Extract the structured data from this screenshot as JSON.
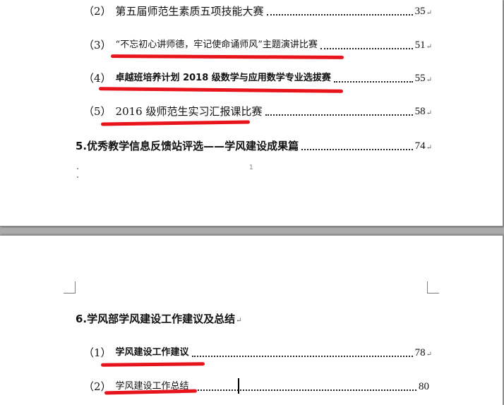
{
  "page1": {
    "entries": [
      {
        "num": "（2）",
        "title": "第五届师范生素质五项技能大赛",
        "page": "35"
      },
      {
        "num": "（3）",
        "title": "“不忘初心讲师德，牢记使命诵师风”主题演讲比赛",
        "page": "51"
      },
      {
        "num": "（4）",
        "title": "卓越班培养计划 2018 级数学与应用数学专业选拔赛",
        "page": "55"
      },
      {
        "num": "（5）",
        "title": "2016 级师范生实习汇报课比赛",
        "page": "58"
      }
    ],
    "section5": {
      "title": "5.优秀教学信息反馈站评选——学风建设成果篇",
      "page": "74"
    },
    "footer_page_number": "1"
  },
  "page2": {
    "section6": {
      "title": "6.学风部学风建设工作建议及总结"
    },
    "entries": [
      {
        "num": "（1）",
        "title": "学风建设工作建议",
        "page": "78"
      },
      {
        "num": "（2）",
        "title": "学风建设工作总结",
        "page": "80"
      }
    ]
  },
  "paragraph_mark": "↵",
  "colors": {
    "annotation_red": "#e8141c",
    "gap_gray": "#ababab"
  }
}
